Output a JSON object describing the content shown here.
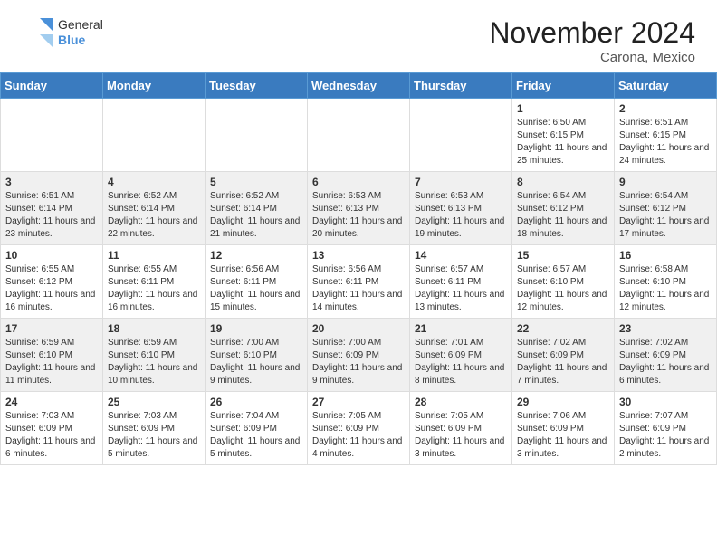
{
  "header": {
    "logo_general": "General",
    "logo_blue": "Blue",
    "month_title": "November 2024",
    "location": "Carona, Mexico"
  },
  "weekdays": [
    "Sunday",
    "Monday",
    "Tuesday",
    "Wednesday",
    "Thursday",
    "Friday",
    "Saturday"
  ],
  "weeks": [
    [
      {
        "day": "",
        "sunrise": "",
        "sunset": "",
        "daylight": ""
      },
      {
        "day": "",
        "sunrise": "",
        "sunset": "",
        "daylight": ""
      },
      {
        "day": "",
        "sunrise": "",
        "sunset": "",
        "daylight": ""
      },
      {
        "day": "",
        "sunrise": "",
        "sunset": "",
        "daylight": ""
      },
      {
        "day": "",
        "sunrise": "",
        "sunset": "",
        "daylight": ""
      },
      {
        "day": "1",
        "sunrise": "Sunrise: 6:50 AM",
        "sunset": "Sunset: 6:15 PM",
        "daylight": "Daylight: 11 hours and 25 minutes."
      },
      {
        "day": "2",
        "sunrise": "Sunrise: 6:51 AM",
        "sunset": "Sunset: 6:15 PM",
        "daylight": "Daylight: 11 hours and 24 minutes."
      }
    ],
    [
      {
        "day": "3",
        "sunrise": "Sunrise: 6:51 AM",
        "sunset": "Sunset: 6:14 PM",
        "daylight": "Daylight: 11 hours and 23 minutes."
      },
      {
        "day": "4",
        "sunrise": "Sunrise: 6:52 AM",
        "sunset": "Sunset: 6:14 PM",
        "daylight": "Daylight: 11 hours and 22 minutes."
      },
      {
        "day": "5",
        "sunrise": "Sunrise: 6:52 AM",
        "sunset": "Sunset: 6:14 PM",
        "daylight": "Daylight: 11 hours and 21 minutes."
      },
      {
        "day": "6",
        "sunrise": "Sunrise: 6:53 AM",
        "sunset": "Sunset: 6:13 PM",
        "daylight": "Daylight: 11 hours and 20 minutes."
      },
      {
        "day": "7",
        "sunrise": "Sunrise: 6:53 AM",
        "sunset": "Sunset: 6:13 PM",
        "daylight": "Daylight: 11 hours and 19 minutes."
      },
      {
        "day": "8",
        "sunrise": "Sunrise: 6:54 AM",
        "sunset": "Sunset: 6:12 PM",
        "daylight": "Daylight: 11 hours and 18 minutes."
      },
      {
        "day": "9",
        "sunrise": "Sunrise: 6:54 AM",
        "sunset": "Sunset: 6:12 PM",
        "daylight": "Daylight: 11 hours and 17 minutes."
      }
    ],
    [
      {
        "day": "10",
        "sunrise": "Sunrise: 6:55 AM",
        "sunset": "Sunset: 6:12 PM",
        "daylight": "Daylight: 11 hours and 16 minutes."
      },
      {
        "day": "11",
        "sunrise": "Sunrise: 6:55 AM",
        "sunset": "Sunset: 6:11 PM",
        "daylight": "Daylight: 11 hours and 16 minutes."
      },
      {
        "day": "12",
        "sunrise": "Sunrise: 6:56 AM",
        "sunset": "Sunset: 6:11 PM",
        "daylight": "Daylight: 11 hours and 15 minutes."
      },
      {
        "day": "13",
        "sunrise": "Sunrise: 6:56 AM",
        "sunset": "Sunset: 6:11 PM",
        "daylight": "Daylight: 11 hours and 14 minutes."
      },
      {
        "day": "14",
        "sunrise": "Sunrise: 6:57 AM",
        "sunset": "Sunset: 6:11 PM",
        "daylight": "Daylight: 11 hours and 13 minutes."
      },
      {
        "day": "15",
        "sunrise": "Sunrise: 6:57 AM",
        "sunset": "Sunset: 6:10 PM",
        "daylight": "Daylight: 11 hours and 12 minutes."
      },
      {
        "day": "16",
        "sunrise": "Sunrise: 6:58 AM",
        "sunset": "Sunset: 6:10 PM",
        "daylight": "Daylight: 11 hours and 12 minutes."
      }
    ],
    [
      {
        "day": "17",
        "sunrise": "Sunrise: 6:59 AM",
        "sunset": "Sunset: 6:10 PM",
        "daylight": "Daylight: 11 hours and 11 minutes."
      },
      {
        "day": "18",
        "sunrise": "Sunrise: 6:59 AM",
        "sunset": "Sunset: 6:10 PM",
        "daylight": "Daylight: 11 hours and 10 minutes."
      },
      {
        "day": "19",
        "sunrise": "Sunrise: 7:00 AM",
        "sunset": "Sunset: 6:10 PM",
        "daylight": "Daylight: 11 hours and 9 minutes."
      },
      {
        "day": "20",
        "sunrise": "Sunrise: 7:00 AM",
        "sunset": "Sunset: 6:09 PM",
        "daylight": "Daylight: 11 hours and 9 minutes."
      },
      {
        "day": "21",
        "sunrise": "Sunrise: 7:01 AM",
        "sunset": "Sunset: 6:09 PM",
        "daylight": "Daylight: 11 hours and 8 minutes."
      },
      {
        "day": "22",
        "sunrise": "Sunrise: 7:02 AM",
        "sunset": "Sunset: 6:09 PM",
        "daylight": "Daylight: 11 hours and 7 minutes."
      },
      {
        "day": "23",
        "sunrise": "Sunrise: 7:02 AM",
        "sunset": "Sunset: 6:09 PM",
        "daylight": "Daylight: 11 hours and 6 minutes."
      }
    ],
    [
      {
        "day": "24",
        "sunrise": "Sunrise: 7:03 AM",
        "sunset": "Sunset: 6:09 PM",
        "daylight": "Daylight: 11 hours and 6 minutes."
      },
      {
        "day": "25",
        "sunrise": "Sunrise: 7:03 AM",
        "sunset": "Sunset: 6:09 PM",
        "daylight": "Daylight: 11 hours and 5 minutes."
      },
      {
        "day": "26",
        "sunrise": "Sunrise: 7:04 AM",
        "sunset": "Sunset: 6:09 PM",
        "daylight": "Daylight: 11 hours and 5 minutes."
      },
      {
        "day": "27",
        "sunrise": "Sunrise: 7:05 AM",
        "sunset": "Sunset: 6:09 PM",
        "daylight": "Daylight: 11 hours and 4 minutes."
      },
      {
        "day": "28",
        "sunrise": "Sunrise: 7:05 AM",
        "sunset": "Sunset: 6:09 PM",
        "daylight": "Daylight: 11 hours and 3 minutes."
      },
      {
        "day": "29",
        "sunrise": "Sunrise: 7:06 AM",
        "sunset": "Sunset: 6:09 PM",
        "daylight": "Daylight: 11 hours and 3 minutes."
      },
      {
        "day": "30",
        "sunrise": "Sunrise: 7:07 AM",
        "sunset": "Sunset: 6:09 PM",
        "daylight": "Daylight: 11 hours and 2 minutes."
      }
    ]
  ]
}
